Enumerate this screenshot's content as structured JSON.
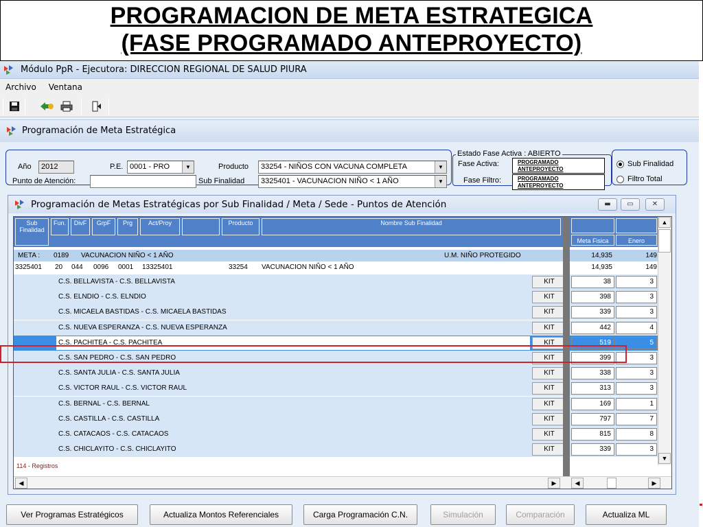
{
  "slide": {
    "title_line1": "PROGRAMACION DE META ESTRATEGICA",
    "title_line2": "(FASE PROGRAMADO ANTEPROYECTO)"
  },
  "window": {
    "title": "Módulo PpR - Ejecutora: DIRECCION REGIONAL DE SALUD PIURA",
    "menu": [
      "Archivo",
      "Ventana"
    ],
    "toolbar_icons": [
      "save-icon",
      "back-icon",
      "print-icon",
      "exit-icon"
    ]
  },
  "inner": {
    "title": "Programación de Meta Estratégica",
    "filters": {
      "anio_label": "Año",
      "anio_value": "2012",
      "pe_label": "P.E.",
      "pe_value": "0001 - PRO",
      "producto_label": "Producto",
      "producto_value": "33254 - NIÑOS CON VACUNA COMPLETA",
      "punto_label": "Punto de Atención:",
      "punto_value": "",
      "subfin_label": "Sub Finalidad",
      "subfin_value": "3325401 - VACUNACION NIÑO < 1 AÑO"
    },
    "estado": {
      "legend": "Estado Fase Activa : ABIERTO",
      "fase_activa_label": "Fase Activa:",
      "fase_activa_l1": "PROGRAMADO",
      "fase_activa_l2": "ANTEPROYECTO",
      "fase_filtro_label": "Fase Filtro:",
      "fase_filtro_l1": "PROGRAMADO",
      "fase_filtro_l2": "ANTEPROYECTO"
    },
    "radios": [
      {
        "label": "Sub Finalidad",
        "checked": true
      },
      {
        "label": "Filtro Total",
        "checked": false
      }
    ]
  },
  "grid_window": {
    "title": "Programación de Metas Estratégicas por Sub Finalidad / Meta / Sede - Puntos de Atención",
    "headers": {
      "sub_finalidad": "Sub Finalidad",
      "fun": "Fun.",
      "divf": "DivF",
      "grpf": "GrpF",
      "prg": "Prg",
      "act_proy": "Act/Proy",
      "producto": "Producto",
      "nombre": "Nombre Sub Finalidad",
      "meta_fisica": "Meta Fisica",
      "enero": "Enero"
    },
    "meta_row": {
      "label": "META :",
      "code": "0189",
      "name": "VACUNACION NIÑO < 1 AÑO",
      "um": "U.M. NIÑO PROTEGIDO",
      "meta_fisica": "14,935",
      "enero": "149"
    },
    "subfin_row": {
      "sub_finalidad": "3325401",
      "fun": "20",
      "divf": "044",
      "grpf": "0096",
      "prg": "0001",
      "act_proy": "13325401",
      "producto": "33254",
      "nombre": "VACUNACION NIÑO < 1 AÑO",
      "meta_fisica": "14,935",
      "enero": "149"
    },
    "kit_label": "KIT",
    "sedes": [
      {
        "name": "C.S.  BELLAVISTA - C.S.  BELLAVISTA",
        "meta": "38",
        "enero": "3"
      },
      {
        "name": "C.S.  ELNDIO - C.S.  ELNDIO",
        "meta": "398",
        "enero": "3"
      },
      {
        "name": "C.S.  MICAELA BASTIDAS - C.S.  MICAELA BASTIDAS",
        "meta": "339",
        "enero": "3"
      },
      {
        "name": "C.S.  NUEVA ESPERANZA - C.S.  NUEVA ESPERANZA",
        "meta": "442",
        "enero": "4"
      },
      {
        "name": "C.S.  PACHITEA - C.S.  PACHITEA",
        "meta": "519",
        "enero": "5"
      },
      {
        "name": "C.S.  SAN PEDRO - C.S.  SAN PEDRO",
        "meta": "399",
        "enero": "3"
      },
      {
        "name": "C.S.  SANTA  JULIA - C.S.  SANTA  JULIA",
        "meta": "338",
        "enero": "3"
      },
      {
        "name": "C.S.  VICTOR RAUL - C.S.  VICTOR RAUL",
        "meta": "313",
        "enero": "3"
      },
      {
        "name": "C.S. BERNAL - C.S. BERNAL",
        "meta": "169",
        "enero": "1"
      },
      {
        "name": "C.S. CASTILLA - C.S. CASTILLA",
        "meta": "797",
        "enero": "7"
      },
      {
        "name": "C.S. CATACAOS - C.S. CATACAOS",
        "meta": "815",
        "enero": "8"
      },
      {
        "name": "C.S. CHICLAYITO - C.S. CHICLAYITO",
        "meta": "339",
        "enero": "3"
      }
    ],
    "records": "114 - Registros"
  },
  "buttons": {
    "ver_programas": "Ver Programas Estratégicos",
    "actualiza_montos": "Actualiza Montos Referenciales",
    "carga_programacion": "Carga Programación C.N.",
    "simulacion": "Simulación",
    "comparacion": "Comparación",
    "actualiza_ml": "Actualiza ML"
  }
}
